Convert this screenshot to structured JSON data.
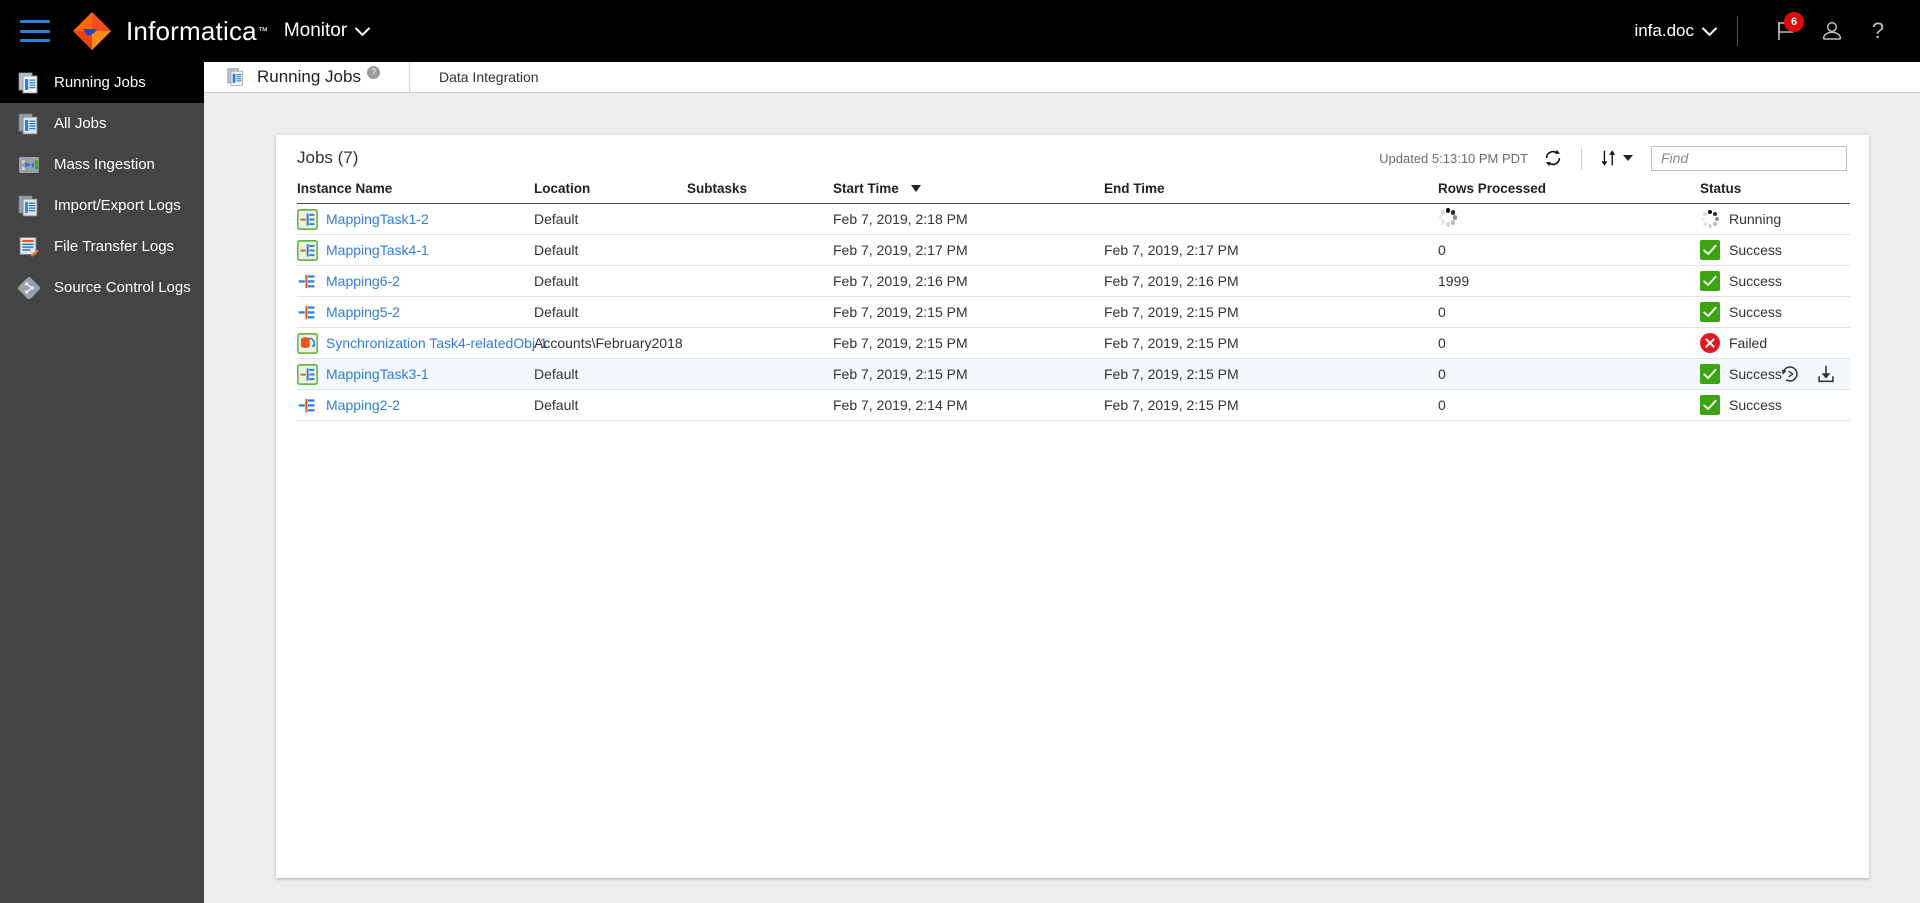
{
  "header": {
    "menu_icon": "hamburger-icon",
    "logo_icon": "informatica-logo-icon",
    "brand": "Informatica",
    "service": "Monitor",
    "service_caret": "chevron-down-icon",
    "user": "infa.doc",
    "user_caret": "chevron-down-icon",
    "notifications_icon": "flag-icon",
    "notifications_count": "6",
    "account_icon": "user-icon",
    "help_icon": "question-mark-icon"
  },
  "sidebar": {
    "items": [
      {
        "label": "Running Jobs",
        "icon": "running-jobs-icon",
        "active": true
      },
      {
        "label": "All Jobs",
        "icon": "all-jobs-icon",
        "active": false
      },
      {
        "label": "Mass Ingestion",
        "icon": "mass-ingestion-icon",
        "active": false
      },
      {
        "label": "Import/Export Logs",
        "icon": "import-export-logs-icon",
        "active": false
      },
      {
        "label": "File Transfer Logs",
        "icon": "file-transfer-logs-icon",
        "active": false
      },
      {
        "label": "Source Control Logs",
        "icon": "source-control-logs-icon",
        "active": false
      }
    ]
  },
  "tabstrip": {
    "icon": "running-jobs-icon",
    "title": "Running Jobs",
    "help_icon": "help-icon",
    "help_glyph": "?",
    "subtitle": "Data Integration"
  },
  "toolbar": {
    "jobs_count_label": "Jobs (7)",
    "updated_label": "Updated 5:13:10 PM PDT",
    "refresh_icon": "refresh-icon",
    "sort_icon": "sort-icon",
    "sort_caret_icon": "caret-down-icon",
    "find_placeholder": "Find",
    "find_value": ""
  },
  "table": {
    "columns": [
      {
        "key": "instance_name",
        "label": "Instance Name",
        "sorted": false
      },
      {
        "key": "location",
        "label": "Location",
        "sorted": false
      },
      {
        "key": "subtasks",
        "label": "Subtasks",
        "sorted": false
      },
      {
        "key": "start_time",
        "label": "Start Time",
        "sorted": true,
        "sort_dir": "desc"
      },
      {
        "key": "end_time",
        "label": "End Time",
        "sorted": false
      },
      {
        "key": "rows_processed",
        "label": "Rows Processed",
        "sorted": false
      },
      {
        "key": "status",
        "label": "Status",
        "sorted": false
      }
    ],
    "rows": [
      {
        "instance_name": "MappingTask1-2",
        "icon": "mapping-task-icon",
        "location": "Default",
        "subtasks": "",
        "start_time": "Feb 7, 2019, 2:18 PM",
        "end_time": "",
        "rows_processed": "",
        "rows_spinner": true,
        "status": "Running",
        "status_kind": "running",
        "selected": false,
        "actions": []
      },
      {
        "instance_name": "MappingTask4-1",
        "icon": "mapping-task-icon",
        "location": "Default",
        "subtasks": "",
        "start_time": "Feb 7, 2019, 2:17 PM",
        "end_time": "Feb 7, 2019, 2:17 PM",
        "rows_processed": "0",
        "rows_spinner": false,
        "status": "Success",
        "status_kind": "success",
        "selected": false,
        "actions": []
      },
      {
        "instance_name": "Mapping6-2",
        "icon": "mapping-icon",
        "location": "Default",
        "subtasks": "",
        "start_time": "Feb 7, 2019, 2:16 PM",
        "end_time": "Feb 7, 2019, 2:16 PM",
        "rows_processed": "1999",
        "rows_spinner": false,
        "status": "Success",
        "status_kind": "success",
        "selected": false,
        "actions": []
      },
      {
        "instance_name": "Mapping5-2",
        "icon": "mapping-icon",
        "location": "Default",
        "subtasks": "",
        "start_time": "Feb 7, 2019, 2:15 PM",
        "end_time": "Feb 7, 2019, 2:15 PM",
        "rows_processed": "0",
        "rows_spinner": false,
        "status": "Success",
        "status_kind": "success",
        "selected": false,
        "actions": []
      },
      {
        "instance_name": "Synchronization Task4-relatedObj-1",
        "icon": "synchronization-task-icon",
        "location": "Accounts\\February2018",
        "subtasks": "",
        "start_time": "Feb 7, 2019, 2:15 PM",
        "end_time": "Feb 7, 2019, 2:15 PM",
        "rows_processed": "0",
        "rows_spinner": false,
        "status": "Failed",
        "status_kind": "failed",
        "selected": false,
        "actions": []
      },
      {
        "instance_name": "MappingTask3-1",
        "icon": "mapping-task-icon",
        "location": "Default",
        "subtasks": "",
        "start_time": "Feb 7, 2019, 2:15 PM",
        "end_time": "Feb 7, 2019, 2:15 PM",
        "rows_processed": "0",
        "rows_spinner": false,
        "status": "Success",
        "status_kind": "success",
        "selected": true,
        "actions": [
          "rerun-icon",
          "download-log-icon"
        ]
      },
      {
        "instance_name": "Mapping2-2",
        "icon": "mapping-icon",
        "location": "Default",
        "subtasks": "",
        "start_time": "Feb 7, 2019, 2:14 PM",
        "end_time": "Feb 7, 2019, 2:15 PM",
        "rows_processed": "0",
        "rows_spinner": false,
        "status": "Success",
        "status_kind": "success",
        "selected": false,
        "actions": []
      }
    ]
  },
  "colors": {
    "header_bg": "#000000",
    "sidebar_bg": "#444444",
    "accent_link": "#2f7ed8",
    "brand_orange": "#ff6600",
    "success_green": "#3aa510",
    "failed_red": "#e01b24",
    "badge_red": "#e00c0c",
    "page_bg": "#ededed"
  }
}
